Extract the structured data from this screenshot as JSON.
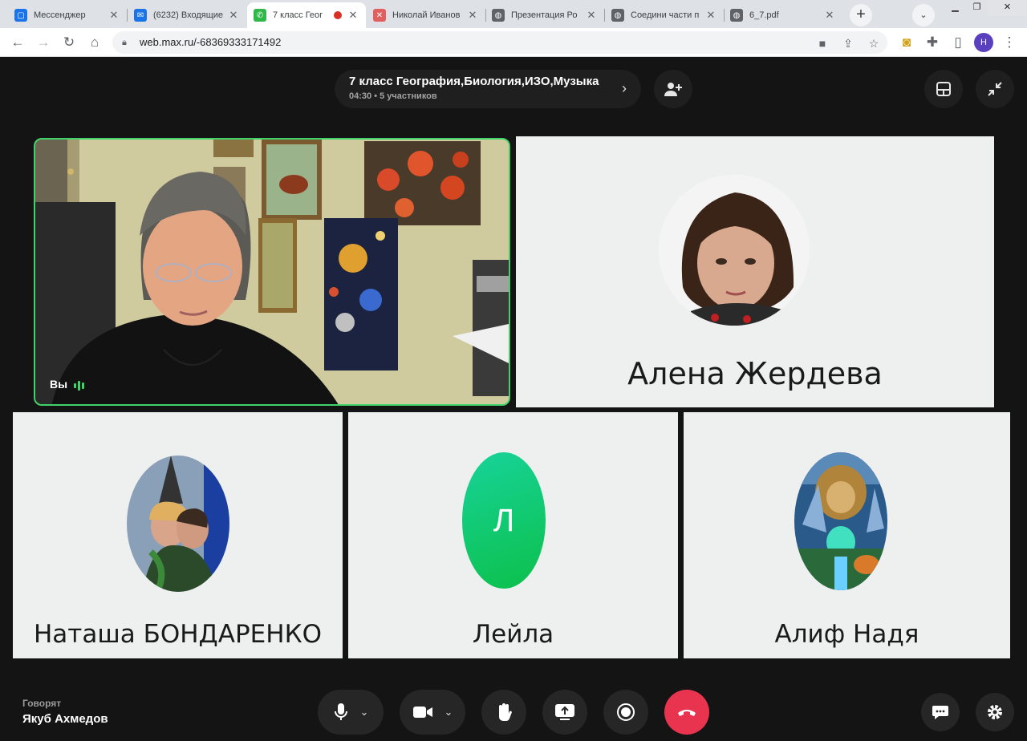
{
  "browser": {
    "tabs": [
      {
        "title": "Мессенджер",
        "fav_color": "#1a73e8",
        "fav_glyph": "▢",
        "active": false
      },
      {
        "title": "(6232) Входящие",
        "fav_color": "#1a73e8",
        "fav_glyph": "✉",
        "active": false
      },
      {
        "title": "7 класс Геог",
        "fav_color": "#2fb84a",
        "fav_glyph": "✆",
        "active": true
      },
      {
        "title": "Николай Иванов",
        "fav_color": "#e06060",
        "fav_glyph": "✕",
        "active": false
      },
      {
        "title": "Презентация Ро",
        "fav_color": "#5f6368",
        "fav_glyph": "◍",
        "active": false
      },
      {
        "title": "Соедини части п",
        "fav_color": "#5f6368",
        "fav_glyph": "◍",
        "active": false
      },
      {
        "title": "6_7.pdf",
        "fav_color": "#5f6368",
        "fav_glyph": "◍",
        "active": false
      }
    ],
    "url": "web.max.ru/-68369333171492",
    "profile_initial": "Н"
  },
  "call": {
    "title": "7 класс География,Биология,ИЗО,Музыка",
    "duration": "04:30",
    "participants_count": "5 участников",
    "self_label": "Вы",
    "participants": [
      {
        "name": "Алена Жердева"
      },
      {
        "name": "Наташа БОНДАРЕНКО"
      },
      {
        "name": "Лейла",
        "initial": "Л"
      },
      {
        "name": "Алиф Надя"
      }
    ],
    "speaking_label": "Говорят",
    "speaking_name": "Якуб Ахмедов"
  },
  "colors": {
    "accent_green": "#3fd36a",
    "end_call": "#e8344e",
    "leila_avatar": "#14c87a"
  }
}
